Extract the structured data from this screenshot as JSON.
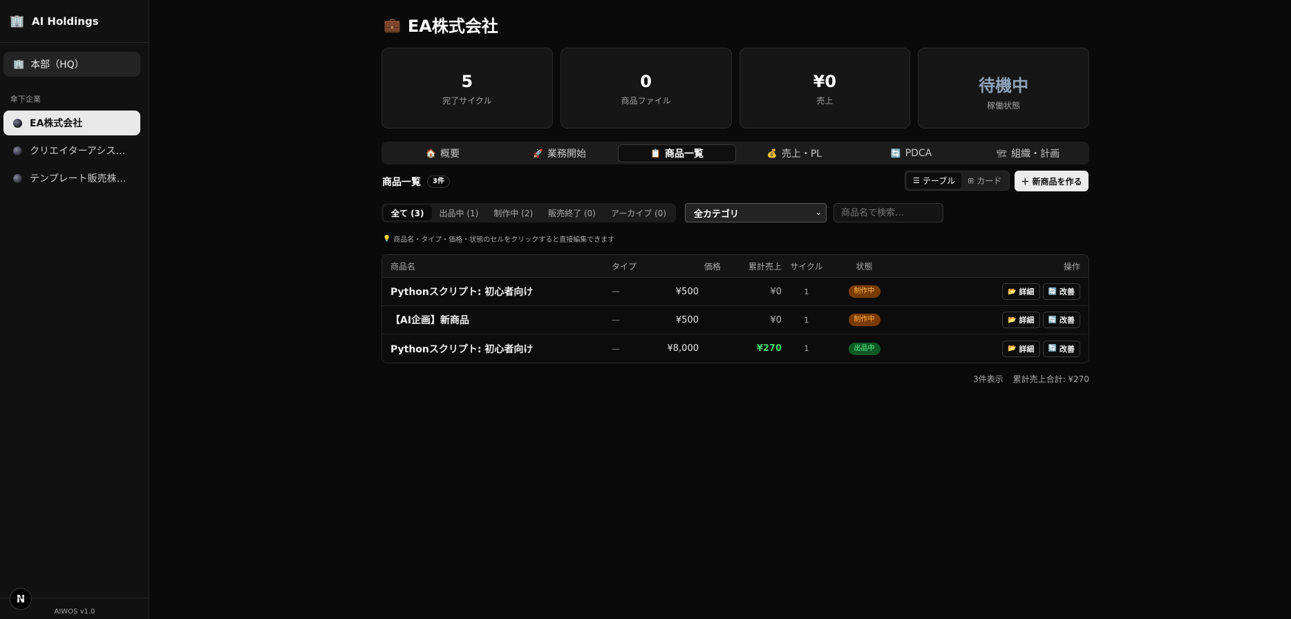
{
  "brand": {
    "logo_icon": "🏢",
    "name": "AI Holdings"
  },
  "sidebar": {
    "hq_icon": "🏢",
    "hq_label": "本部（HQ）",
    "section_label": "傘下企業",
    "companies": [
      {
        "label": "EA株式会社",
        "active": true
      },
      {
        "label": "クリエイターアシス…",
        "active": false
      },
      {
        "label": "テンプレート販売株…",
        "active": false
      }
    ],
    "version": "AIWOS v1.0",
    "avatar_letter": "N"
  },
  "page": {
    "title_icon": "💼",
    "title": "EA株式会社"
  },
  "stats": [
    {
      "value": "5",
      "label": "完了サイクル"
    },
    {
      "value": "0",
      "label": "商品ファイル"
    },
    {
      "value": "¥0",
      "label": "売上"
    },
    {
      "value": "待機中",
      "label": "稼働状態"
    }
  ],
  "tabs": [
    {
      "icon": "🏠",
      "label": "概要"
    },
    {
      "icon": "🚀",
      "label": "業務開始"
    },
    {
      "icon": "📋",
      "label": "商品一覧",
      "active": true
    },
    {
      "icon": "💰",
      "label": "売上・PL"
    },
    {
      "icon": "🔄",
      "label": "PDCA"
    },
    {
      "icon": "🏗",
      "label": "組織・計画"
    }
  ],
  "list": {
    "title": "商品一覧",
    "count": "3件",
    "view_table": "テーブル",
    "view_card": "カード",
    "new_button": "＋ 新商品を作る"
  },
  "filters": {
    "tabs": [
      "全て (3)",
      "出品中 (1)",
      "制作中 (2)",
      "販売終了 (0)",
      "アーカイブ (0)"
    ],
    "category_selected": "全カテゴリ",
    "search_placeholder": "商品名で検索…"
  },
  "hint": {
    "icon": "💡",
    "text": "商品名・タイプ・価格・状態のセルをクリックすると直接編集できます"
  },
  "table": {
    "headers": {
      "name": "商品名",
      "type": "タイプ",
      "price": "価格",
      "sales": "累計売上",
      "cycle": "サイクル",
      "status": "状態",
      "ops": "操作"
    },
    "rows": [
      {
        "name": "Pythonスクリプト: 初心者向け",
        "type": "—",
        "price": "¥500",
        "sales": "¥0",
        "cycle": "1",
        "status": "制作中"
      },
      {
        "name": "【AI企画】新商品",
        "type": "—",
        "price": "¥500",
        "sales": "¥0",
        "cycle": "1",
        "status": "制作中"
      },
      {
        "name": "Pythonスクリプト: 初心者向け",
        "type": "—",
        "price": "¥8,000",
        "sales": "¥270",
        "cycle": "1",
        "status": "出品中"
      }
    ],
    "detail_button": "詳細",
    "improve_button": "改善"
  },
  "summary": {
    "shown": "3件表示",
    "total": "累計売上合計: ¥270"
  },
  "colors": {
    "accent_green": "#3ddc6e",
    "making_badge": "#7a3b00",
    "selling_badge": "#0d5a25",
    "idle_status": "#8fa3b8"
  }
}
